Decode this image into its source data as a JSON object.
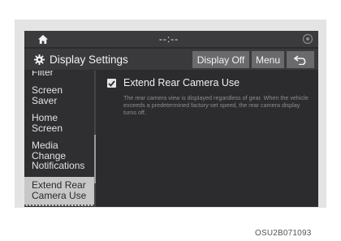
{
  "status_bar": {
    "home_icon": "home-icon",
    "clock": "--:--",
    "status_icon": "signal-icon"
  },
  "header": {
    "settings_icon": "gear-icon",
    "title": "Display Settings",
    "display_off_label": "Display Off",
    "menu_label": "Menu",
    "back_icon": "back-icon"
  },
  "sidebar": {
    "items": [
      {
        "label": "Filter"
      },
      {
        "label": "Screen\nSaver"
      },
      {
        "label": "Home\nScreen"
      },
      {
        "label": "Media\nChange\nNotifications"
      },
      {
        "label": "Extend Rear\nCamera Use"
      }
    ],
    "active_index": 4
  },
  "content": {
    "option": {
      "checked": true,
      "label": "Extend Rear Camera Use",
      "description": "The rear camera view is displayed regardless of gear. When the vehicle exceeds a predetermined factory-set speed, the rear camera display turns off."
    }
  },
  "caption": "OSU2B071093",
  "colors": {
    "screen_bg": "#2c2c2e",
    "header_bg": "#3a3a3c",
    "button_bg": "#6a6a6c",
    "active_item_bg": "#c7c7c7",
    "text": "#f0f0f0",
    "muted_text": "#8c8c8e"
  }
}
